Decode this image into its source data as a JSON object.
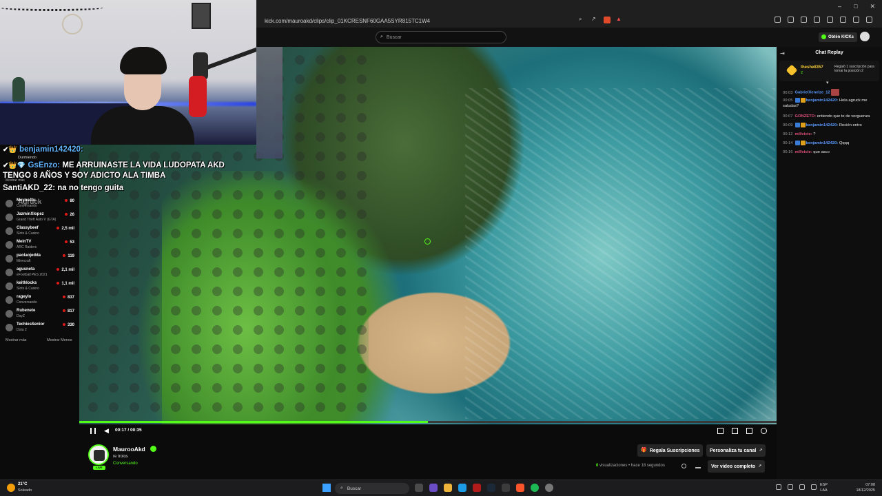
{
  "browser": {
    "url": "kick.com/mauroakd/clips/clip_01KCRESNF60GAA5SYR815TC1W4",
    "window_controls": [
      "–",
      "□",
      "✕"
    ]
  },
  "header": {
    "search_placeholder": "Buscar",
    "cta_label": "Obtén KICKs"
  },
  "overlay_chat": [
    {
      "user": "benjamin142420:",
      "text": "",
      "status": "Durmiendo"
    },
    {
      "user": "GsEnzo:",
      "text": "ME ARRUINASTE LA VIDA LUDOPATA AKD"
    },
    {
      "text": "TENGO 8 AÑOS Y SOY ADICTO ALA TIMBA"
    },
    {
      "user": "SantiAKD_22:",
      "text": "na no tengo guita"
    },
    {
      "ghost": "Mostrar más"
    },
    {
      "ghost2": "Agruck"
    }
  ],
  "left_list": {
    "items": [
      {
        "name": "Meyne4tu",
        "category": "Conversando",
        "count": "80"
      },
      {
        "name": "JazminXlopez",
        "category": "Grand Theft Auto V (GTA)",
        "count": "26"
      },
      {
        "name": "Classybeef",
        "category": "Slots & Casino",
        "count": "2,5 mil"
      },
      {
        "name": "MelnTV",
        "category": "ARC Raiders",
        "count": "53"
      },
      {
        "name": "paolaojedda",
        "category": "Minecraft",
        "count": "119"
      },
      {
        "name": "agusneta",
        "category": "eFootball PES 2021",
        "count": "2,1 mil"
      },
      {
        "name": "keithlocks",
        "category": "Slots & Casino",
        "count": "1,1 mil"
      },
      {
        "name": "rageylo",
        "category": "Conversando",
        "count": "837"
      },
      {
        "name": "Rubenete",
        "category": "DayZ",
        "count": "817"
      },
      {
        "name": "TechiesSenior",
        "category": "Dota 2",
        "count": "330"
      }
    ],
    "show_more": "Mostrar más",
    "show_less": "Mostrar Menos"
  },
  "player": {
    "time": "00:17 / 00:35",
    "progress": 0.5
  },
  "chat": {
    "title": "Chat Replay",
    "pinned": {
      "user": "theshe8357",
      "count": "2",
      "text": "Regaló 1 suscripción para tomar la posición 2"
    },
    "messages": [
      {
        "time": "00:03",
        "user": "GabrielXenelze_12",
        "user_color": "#5a9bff",
        "text": ""
      },
      {
        "time": "00:05",
        "user": "benjamin142420:",
        "user_color": "#5a9bff",
        "text": "Hola agruck me saludas?"
      },
      {
        "time": "00:07",
        "user": "GONZETO:",
        "user_color": "#e0507a",
        "text": "entiendo que te de verguenza"
      },
      {
        "time": "00:09",
        "user": "benjamin142420:",
        "user_color": "#5a9bff",
        "text": "Recién entro"
      },
      {
        "time": "00:12",
        "user": "millvicte:",
        "user_color": "#e0507a",
        "text": "?"
      },
      {
        "time": "00:14",
        "user": "benjamin142420:",
        "user_color": "#5a9bff",
        "text": "Qqqq"
      },
      {
        "time": "00:16",
        "user": "millvicte:",
        "user_color": "#e0507a",
        "text": "que asco"
      }
    ]
  },
  "channel": {
    "name": "MaurooAkd",
    "clip_title": "re trolos",
    "category": "Conversando",
    "live_badge": "LIVE",
    "subs_button": "Regala Suscripciones",
    "customize_button": "Personaliza tu canal",
    "views_count": "0",
    "views_label": "visualizaciones",
    "ago": "• hace 18 segundos",
    "full_video_button": "Ver video completo"
  },
  "taskbar": {
    "temp": "21°C",
    "weather": "Soleado",
    "search": "Buscar",
    "lang_top": "ESP",
    "lang_bottom": "LAA",
    "time": "07:08",
    "date": "18/12/2025"
  },
  "colors": {
    "kick_green": "#53fc18",
    "bg": "#0b0b0c"
  }
}
